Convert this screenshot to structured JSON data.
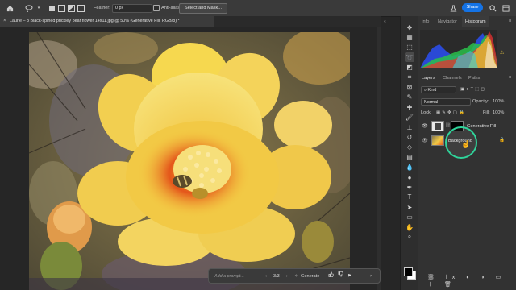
{
  "options_bar": {
    "feather_label": "Feather:",
    "feather_value": "0 px",
    "antialias_label": "Anti-alias",
    "select_mask_label": "Select and Mask...",
    "share_label": "Share"
  },
  "document": {
    "tab_title": "Laurie – 3 Black-spined prickley pear flower 14x11.jpg @ 50% (Generative Fill, RGB/8) *",
    "close_glyph": "×"
  },
  "context_bar": {
    "prompt_placeholder": "Add a prompt...",
    "counter": "3/3",
    "generate_label": "Generate"
  },
  "panels": {
    "top_tabs": [
      "Info",
      "Navigator",
      "Histogram"
    ],
    "layer_tabs": [
      "Layers",
      "Channels",
      "Paths"
    ],
    "kind_label": "Kind",
    "blend_mode": "Normal",
    "opacity_label": "Opacity:",
    "opacity_value": "100%",
    "lock_label": "Lock:",
    "fill_label": "Fill:",
    "fill_value": "100%"
  },
  "layers": [
    {
      "name": "Generative Fill",
      "visible": true
    },
    {
      "name": "Background",
      "visible": true,
      "locked": true
    }
  ],
  "toolbar_icons": [
    "move-tool-icon",
    "artboard-icon",
    "marquee-tool-icon",
    "lasso-tool-icon",
    "object-select-icon",
    "crop-tool-icon",
    "frame-tool-icon",
    "eyedropper-icon",
    "healing-brush-icon",
    "brush-tool-icon",
    "clone-stamp-icon",
    "history-brush-icon",
    "eraser-icon",
    "gradient-tool-icon",
    "blur-tool-icon",
    "dodge-tool-icon",
    "pen-tool-icon",
    "type-tool-icon",
    "path-select-icon",
    "rectangle-tool-icon",
    "hand-tool-icon",
    "zoom-tool-icon",
    "more-tools-icon"
  ],
  "colors": {
    "accent": "#1473e6",
    "cursor_ring": "#2fd39a",
    "panel_bg": "#323232"
  }
}
